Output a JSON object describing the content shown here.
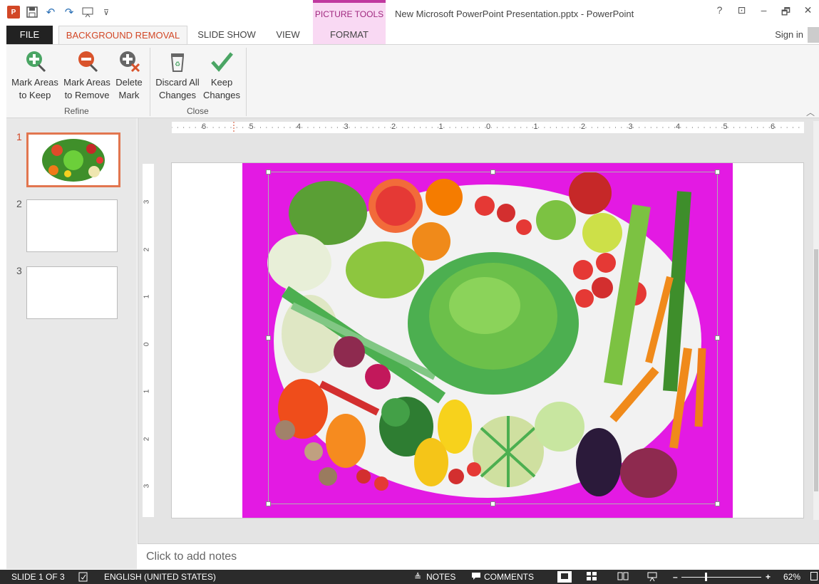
{
  "window": {
    "doc_title": "New Microsoft PowerPoint Presentation.pptx - PowerPoint",
    "contextual_tab_group": "PICTURE TOOLS",
    "help": "?",
    "restore_ribbon": "⊡",
    "minimize": "–",
    "maximize": "🗗",
    "close": "✕"
  },
  "qat": {
    "logo_text": "P",
    "undo": "↶",
    "redo": "↷",
    "customize": "⊽"
  },
  "tabs": {
    "file": "FILE",
    "background_removal": "BACKGROUND REMOVAL",
    "slide_show": "SLIDE SHOW",
    "view": "VIEW",
    "format": "FORMAT",
    "sign_in": "Sign in"
  },
  "ribbon": {
    "refine": {
      "label": "Refine",
      "mark_keep": [
        "Mark Areas",
        "to Keep"
      ],
      "mark_remove": [
        "Mark Areas",
        "to Remove"
      ],
      "delete_mark": [
        "Delete",
        "Mark"
      ]
    },
    "close": {
      "label": "Close",
      "discard": [
        "Discard All",
        "Changes"
      ],
      "keep": [
        "Keep",
        "Changes"
      ]
    }
  },
  "slides": [
    {
      "number": "1",
      "selected": true
    },
    {
      "number": "2",
      "selected": false
    },
    {
      "number": "3",
      "selected": false
    }
  ],
  "ruler": {
    "h_labels": [
      "6",
      "5",
      "4",
      "3",
      "2",
      "1",
      "0",
      "1",
      "2",
      "3",
      "4",
      "5",
      "6"
    ],
    "v_labels": [
      "3",
      "2",
      "1",
      "0",
      "1",
      "2",
      "3"
    ]
  },
  "notes_placeholder": "Click to add notes",
  "status": {
    "slide": "SLIDE 1 OF 3",
    "language": "ENGLISH (UNITED STATES)",
    "notes": "NOTES",
    "comments": "COMMENTS",
    "zoom": "62%",
    "zoom_level": 0.62
  },
  "colors": {
    "accent": "#d24726",
    "removal_magenta": "#e31ae3",
    "picture_tools": "#f9d9f3"
  }
}
